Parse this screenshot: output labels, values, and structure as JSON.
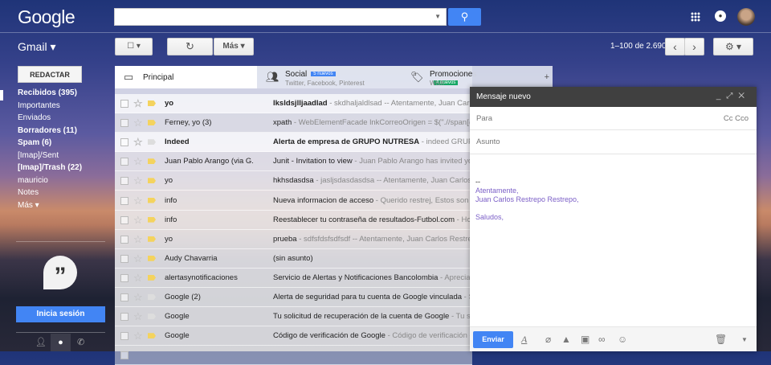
{
  "header": {
    "logo": "Google",
    "search_value": "",
    "apps_icon": "apps-grid-icon",
    "notifications_icon": "bell-icon"
  },
  "toolbar": {
    "app_label": "Gmail ▾",
    "select": "☐ ▾",
    "refresh": "↻",
    "more": "Más ▾",
    "range": "1–100 de 2.690",
    "prev": "‹",
    "next": "›",
    "settings": "⚙ ▾"
  },
  "sidebar": {
    "compose": "REDACTAR",
    "items": [
      {
        "label": "Recibidos (395)",
        "bold": true
      },
      {
        "label": "Importantes",
        "bold": false
      },
      {
        "label": "Enviados",
        "bold": false
      },
      {
        "label": "Borradores (11)",
        "bold": true
      },
      {
        "label": "Spam (6)",
        "bold": true
      },
      {
        "label": "[Imap]/Sent",
        "bold": false
      },
      {
        "label": "[Imap]/Trash (22)",
        "bold": true
      },
      {
        "label": "mauricio",
        "bold": false
      },
      {
        "label": "Notes",
        "bold": false
      },
      {
        "label": "Más ▾",
        "bold": false
      }
    ],
    "hangouts_signin": "Inicia sesión"
  },
  "tabs": [
    {
      "label": "Principal",
      "sub": "",
      "badge": ""
    },
    {
      "label": "Social",
      "sub": "Twitter, Facebook, Pinterest",
      "badge": "5 nuevos",
      "badge_color": "#4285f4"
    },
    {
      "label": "Promociones",
      "sub": "Wish",
      "badge": "4 nuevos",
      "badge_color": "#16a765"
    }
  ],
  "emails": [
    {
      "from": "yo",
      "subject": "lksldsjlljaadlad",
      "snippet": " - skdhaljaldlsad -- Atentamente, Juan Carlos",
      "unread": true,
      "label": true
    },
    {
      "from": "Ferney, yo (3)",
      "subject": "xpath",
      "snippet": " - WebElementFacade lnkCorreoOrigen = $(\".//span[@e",
      "unread": false,
      "label": true
    },
    {
      "from": "Indeed",
      "subject": "Alerta de empresa de GRUPO NUTRESA",
      "snippet": " - indeed GRUPO",
      "unread": true,
      "label": false
    },
    {
      "from": "Juan Pablo Arango (via G.",
      "subject": "Junit - Invitation to view",
      "snippet": " - Juan Pablo Arango has invited you t",
      "unread": false,
      "label": true
    },
    {
      "from": "yo",
      "subject": "hkhsdasdsa",
      "snippet": " - jasljsdasdasdsa -- Atentamente, Juan Carlos R",
      "unread": false,
      "label": true
    },
    {
      "from": "info",
      "subject": "Nueva informacion de acceso",
      "snippet": " - Querido restrej, Estos son los",
      "unread": false,
      "label": true
    },
    {
      "from": "info",
      "subject": "Reestablecer tu contraseña de resultados-Futbol.com",
      "snippet": " - Hola r",
      "unread": false,
      "label": true
    },
    {
      "from": "yo",
      "subject": "prueba",
      "snippet": " - sdfsfdsfsdfsdf -- Atentamente, Juan Carlos Restrepo",
      "unread": false,
      "label": true
    },
    {
      "from": "Audy Chavarria",
      "subject": "(sin asunto)",
      "snippet": "",
      "unread": false,
      "label": true
    },
    {
      "from": "alertasynotificaciones",
      "subject": "Servicio de Alertas y Notificaciones Bancolombia",
      "snippet": " - Apreciado",
      "unread": false,
      "label": true
    },
    {
      "from": "Google (2)",
      "subject": "Alerta de seguridad para tu cuenta de Google vinculada",
      "snippet": " - Soli",
      "unread": false,
      "label": false
    },
    {
      "from": "Google",
      "subject": "Tu solicitud de recuperación de la cuenta de Google",
      "snippet": " - Tu solic",
      "unread": false,
      "label": false
    },
    {
      "from": "Google",
      "subject": "Código de verificación de Google",
      "snippet": " - Código de verificación de",
      "unread": false,
      "label": true
    }
  ],
  "compose": {
    "title": "Mensaje nuevo",
    "to_placeholder": "Para",
    "cc": "Cc",
    "bcc": "Cco",
    "subject_placeholder": "Asunto",
    "sig_dash": "--",
    "sig_lines": [
      "Atentamente,",
      "Juan Carlos Restrepo Restrepo,",
      "",
      "Saludos,"
    ],
    "send": "Enviar"
  }
}
